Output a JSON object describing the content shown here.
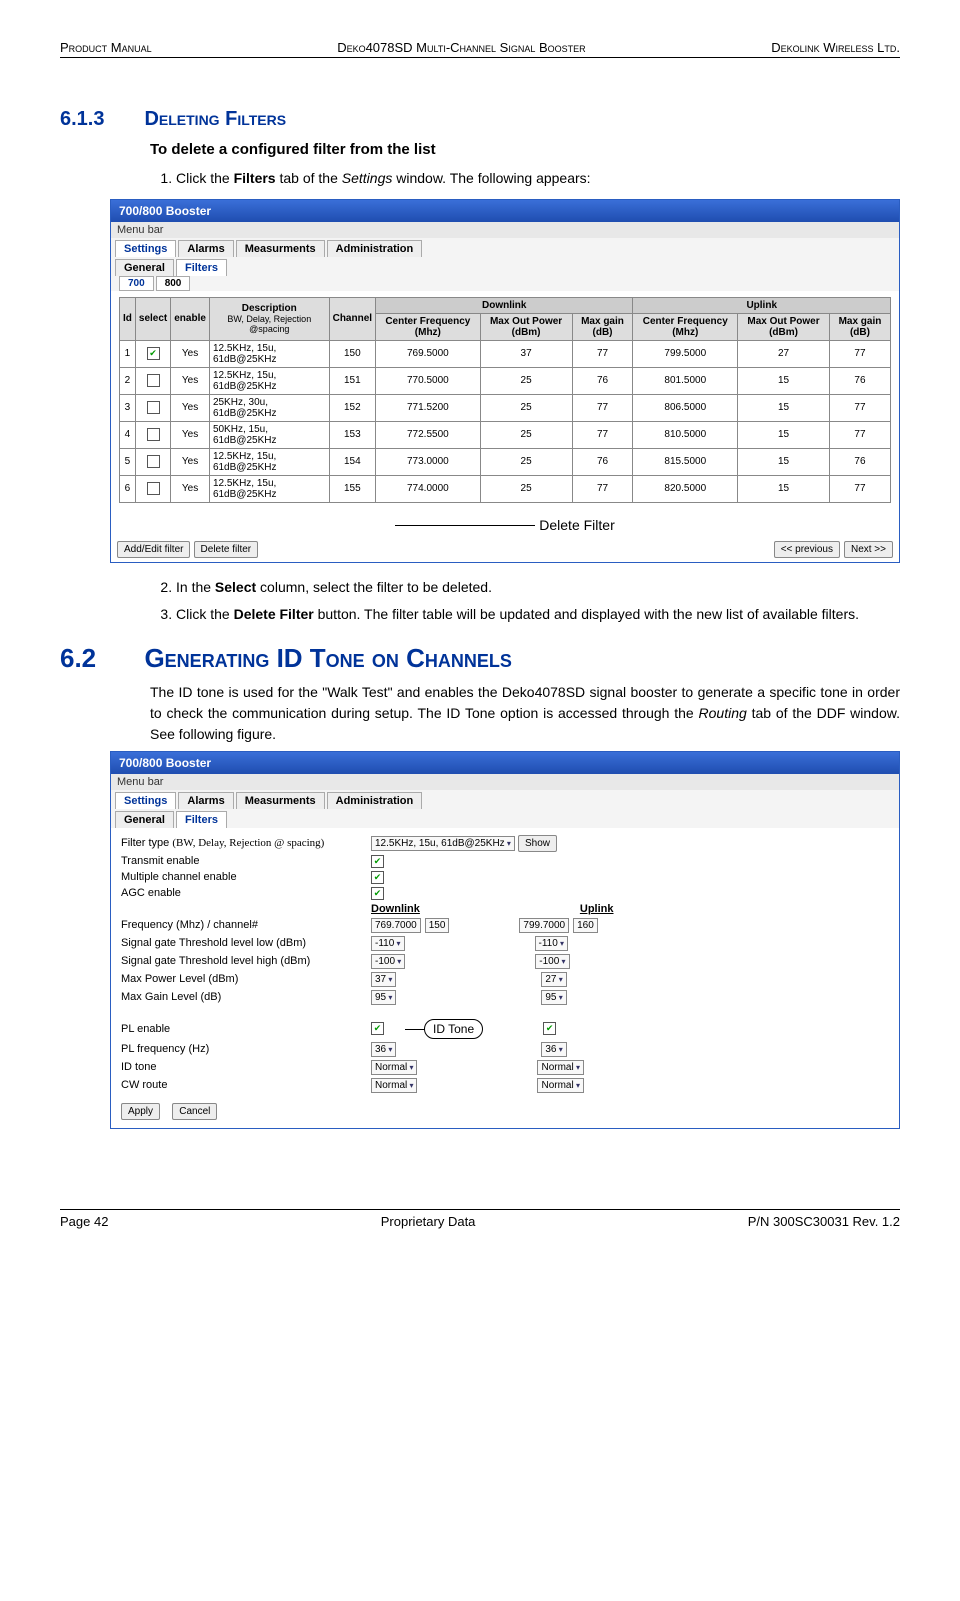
{
  "header": {
    "left": "Product Manual",
    "center": "Deko4078SD Multi-Channel Signal Booster",
    "right": "Dekolink Wireless Ltd."
  },
  "sec613": {
    "num": "6.1.3",
    "title": "Deleting Filters",
    "subhead": "To delete a configured filter from the list",
    "step1_pre": "Click the ",
    "step1_bold": "Filters",
    "step1_mid": " tab of the ",
    "step1_ital": "Settings",
    "step1_post": " window. The following appears:",
    "annot": "Delete Filter",
    "step2_pre": "In the ",
    "step2_bold": "Select",
    "step2_post": " column, select the filter to be deleted.",
    "step3_pre": "Click the ",
    "step3_bold": "Delete Filter",
    "step3_post": " button. The filter table will be updated and displayed with the new list of available filters."
  },
  "win1": {
    "title": "700/800 Booster",
    "menubar": "Menu bar",
    "tabs": [
      "Settings",
      "Alarms",
      "Measurments",
      "Administration"
    ],
    "tabs2": [
      "General",
      "Filters"
    ],
    "tabs3": [
      "700",
      "800"
    ],
    "headers": {
      "id": "Id",
      "select": "select",
      "enable": "enable",
      "desc_title": "Description",
      "desc_sub": "BW, Delay, Rejection @spacing",
      "channel": "Channel",
      "dl": "Downlink",
      "ul": "Uplink",
      "cf": "Center Frequency (Mhz)",
      "mop": "Max Out Power (dBm)",
      "mg": "Max gain (dB)"
    },
    "rows": [
      {
        "id": "1",
        "sel": true,
        "en": "Yes",
        "desc": "12.5KHz, 15u, 61dB@25KHz",
        "ch": "150",
        "dlc": "769.5000",
        "dlp": "37",
        "dlg": "77",
        "ulc": "799.5000",
        "ulp": "27",
        "ulg": "77"
      },
      {
        "id": "2",
        "sel": false,
        "en": "Yes",
        "desc": "12.5KHz, 15u, 61dB@25KHz",
        "ch": "151",
        "dlc": "770.5000",
        "dlp": "25",
        "dlg": "76",
        "ulc": "801.5000",
        "ulp": "15",
        "ulg": "76"
      },
      {
        "id": "3",
        "sel": false,
        "en": "Yes",
        "desc": "25KHz,   30u, 61dB@25KHz",
        "ch": "152",
        "dlc": "771.5200",
        "dlp": "25",
        "dlg": "77",
        "ulc": "806.5000",
        "ulp": "15",
        "ulg": "77"
      },
      {
        "id": "4",
        "sel": false,
        "en": "Yes",
        "desc": "50KHz,   15u, 61dB@25KHz",
        "ch": "153",
        "dlc": "772.5500",
        "dlp": "25",
        "dlg": "77",
        "ulc": "810.5000",
        "ulp": "15",
        "ulg": "77"
      },
      {
        "id": "5",
        "sel": false,
        "en": "Yes",
        "desc": "12.5KHz, 15u, 61dB@25KHz",
        "ch": "154",
        "dlc": "773.0000",
        "dlp": "25",
        "dlg": "76",
        "ulc": "815.5000",
        "ulp": "15",
        "ulg": "76"
      },
      {
        "id": "6",
        "sel": false,
        "en": "Yes",
        "desc": "12.5KHz, 15u, 61dB@25KHz",
        "ch": "155",
        "dlc": "774.0000",
        "dlp": "25",
        "dlg": "77",
        "ulc": "820.5000",
        "ulp": "15",
        "ulg": "77"
      }
    ],
    "btn_addedit": "Add/Edit filter",
    "btn_delete": "Delete filter",
    "btn_prev": "<< previous",
    "btn_next": "Next >>"
  },
  "sec62": {
    "num": "6.2",
    "title": "Generating ID Tone on Channels",
    "para_pre": "The ID tone is used for the \"Walk Test\" and enables the Deko4078SD signal booster to generate a specific tone in order to check the communication during setup. The ID Tone option is accessed through the ",
    "para_ital": "Routing",
    "para_post": " tab of the DDF window. See following figure."
  },
  "win2": {
    "title": "700/800 Booster",
    "menubar": "Menu bar",
    "tabs": [
      "Settings",
      "Alarms",
      "Measurments",
      "Administration"
    ],
    "tabs2": [
      "General",
      "Filters"
    ],
    "lbl_filtertype_pre": "Filter type ",
    "lbl_filtertype_paren": "(BW, Delay, Rejection @ spacing)",
    "sel_filtertype": "12.5KHz, 15u, 61dB@25KHz",
    "btn_show": "Show",
    "lbl_txen": "Transmit enable",
    "lbl_multi": "Multiple channel enable",
    "lbl_agc": "AGC enable",
    "hdr_dl": "Downlink",
    "hdr_ul": "Uplink",
    "lbl_freq": "Frequency  (Mhz)       / channel#",
    "dl_freq": "769.7000",
    "dl_ch": "150",
    "ul_freq": "799.7000",
    "ul_ch": "160",
    "lbl_sglow": "Signal gate Threshold level low (dBm)",
    "dl_sglow": "-110",
    "ul_sglow": "-110",
    "lbl_sghigh": "Signal gate Threshold level high (dBm)",
    "dl_sghigh": "-100",
    "ul_sghigh": "-100",
    "lbl_maxpow": "Max Power Level (dBm)",
    "dl_maxpow": "37",
    "ul_maxpow": "27",
    "lbl_maxgain": "Max Gain Level (dB)",
    "dl_maxgain": "95",
    "ul_maxgain": "95",
    "lbl_plen": "PL enable",
    "lbl_plfreq": "PL frequency (Hz)",
    "dl_plfreq": "36",
    "ul_plfreq": "36",
    "lbl_idtone": "ID tone",
    "dl_idtone": "Normal",
    "ul_idtone": "Normal",
    "lbl_cwroute": "CW route",
    "dl_cw": "Normal",
    "ul_cw": "Normal",
    "callout": "ID Tone",
    "btn_apply": "Apply",
    "btn_cancel": "Cancel"
  },
  "footer": {
    "left": "Page 42",
    "center": "Proprietary Data",
    "right": "P/N 300SC30031 Rev. 1.2"
  }
}
